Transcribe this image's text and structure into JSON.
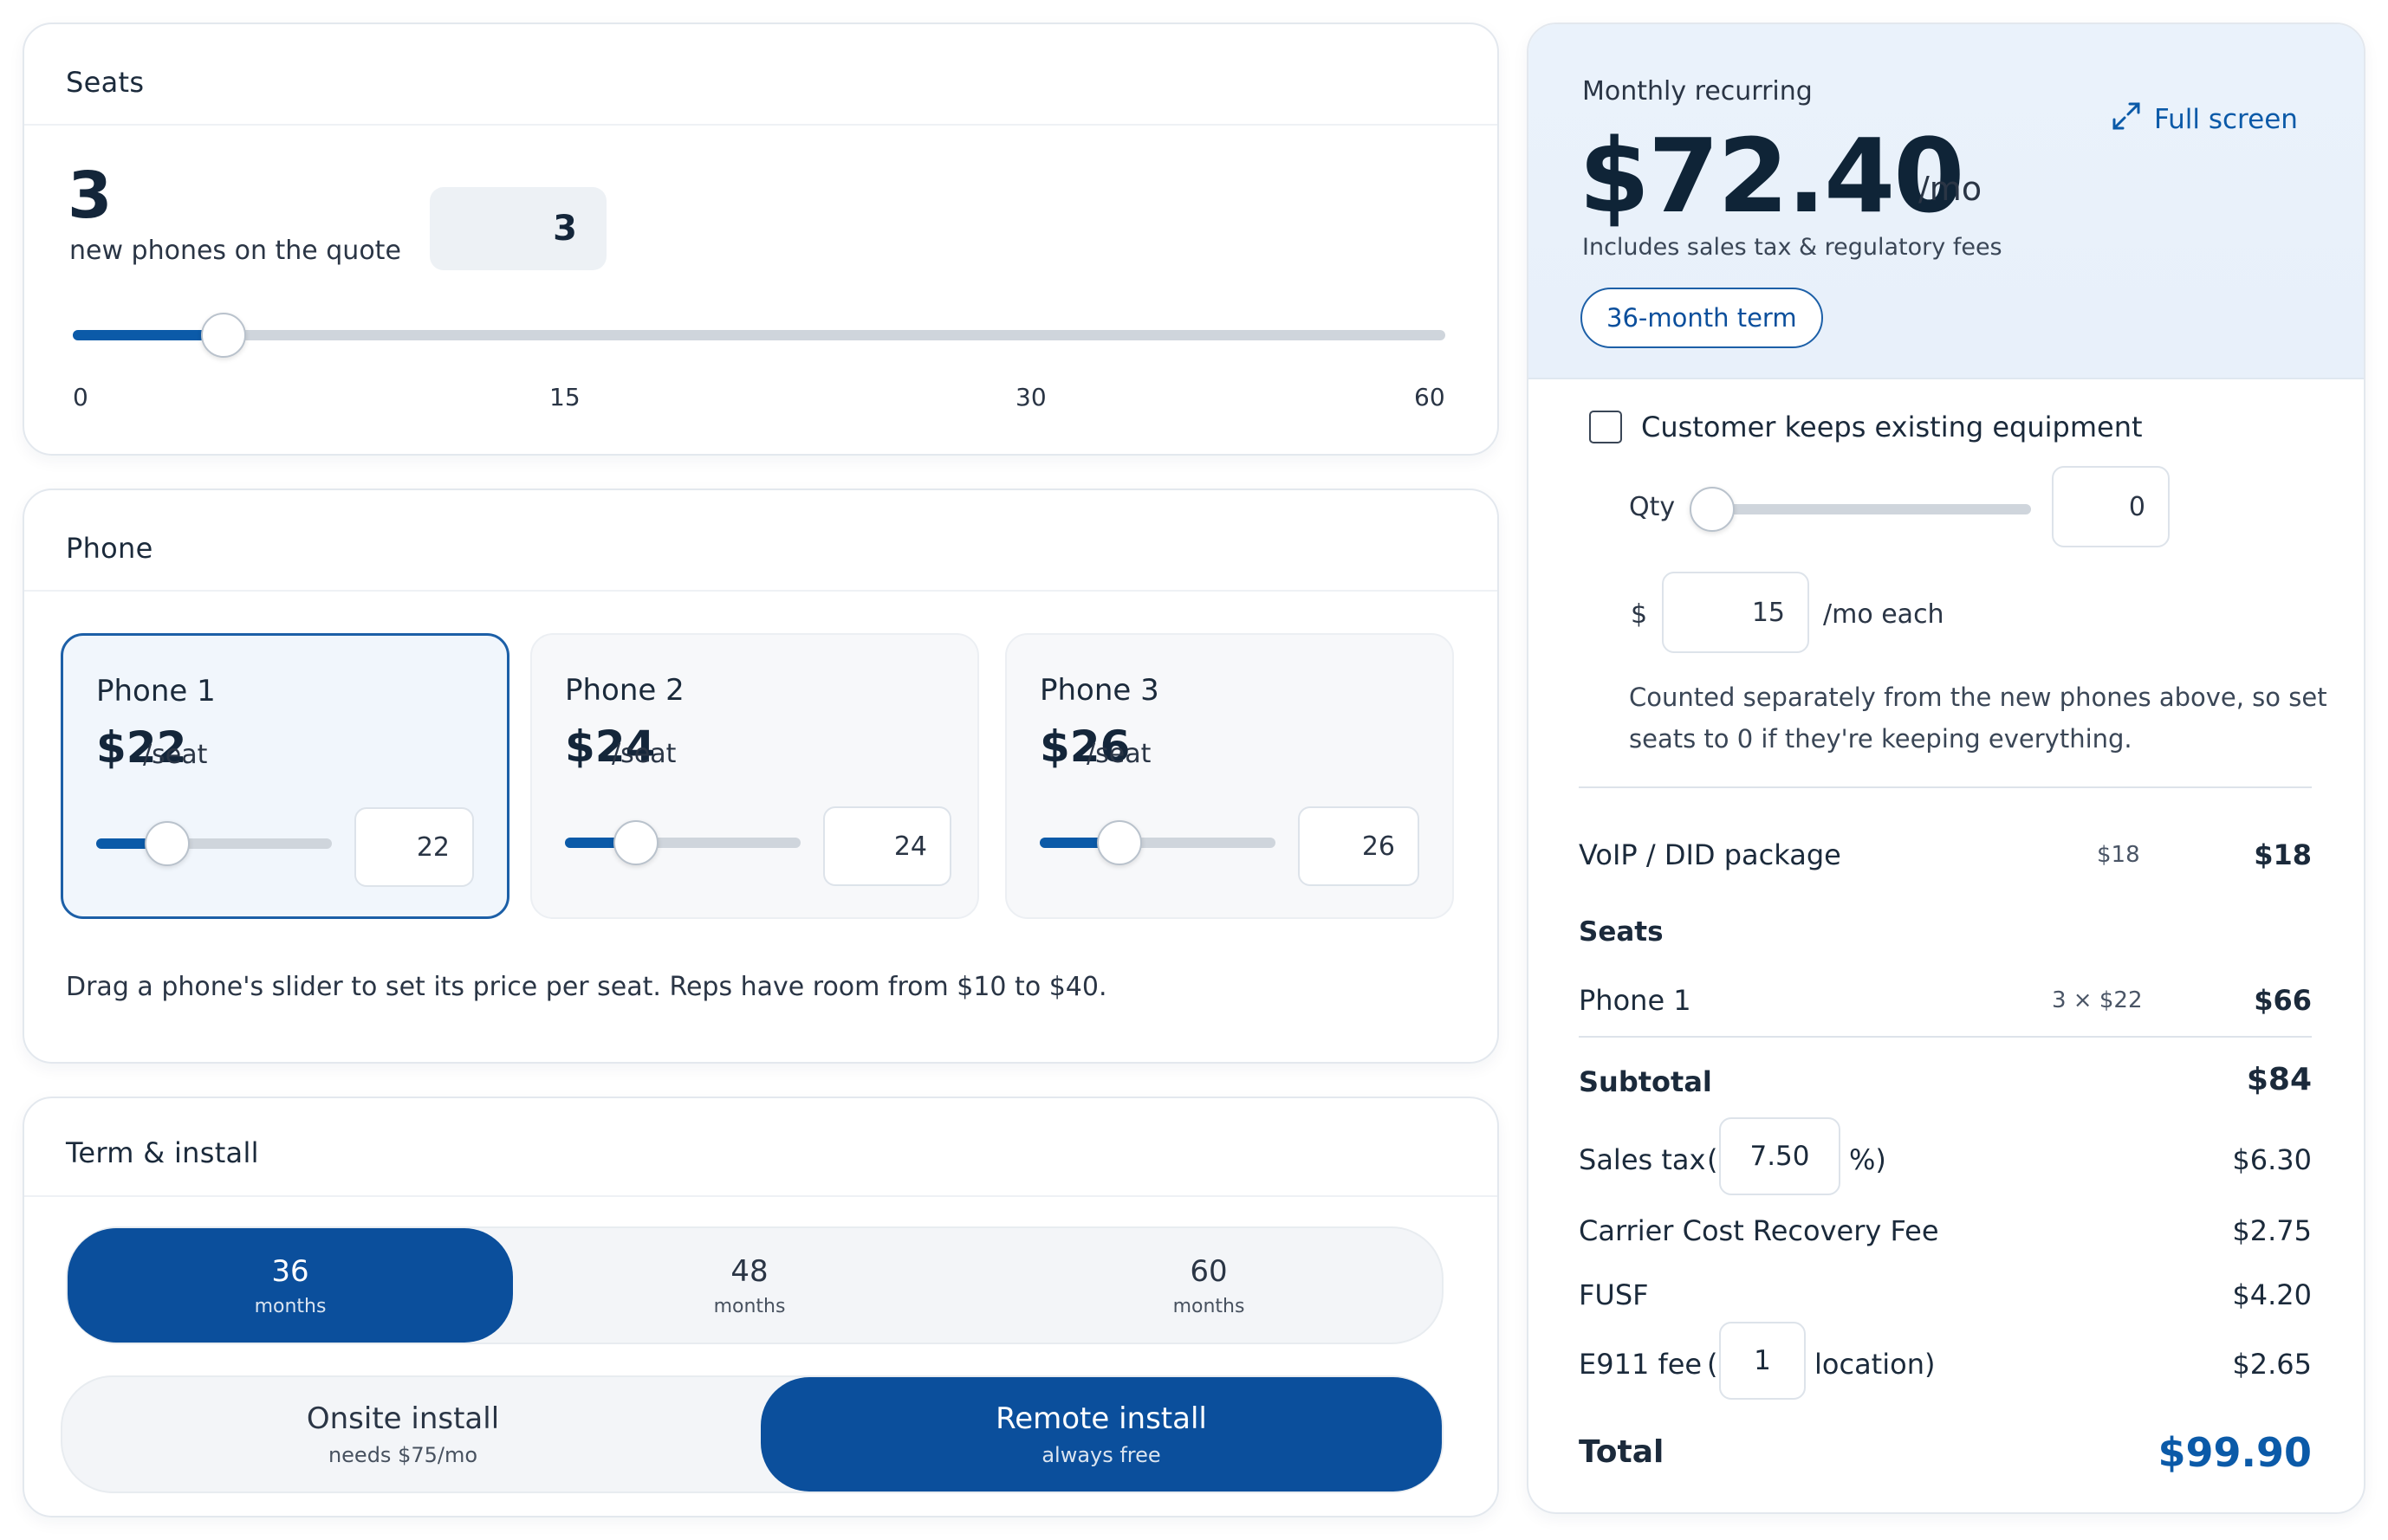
{
  "seats": {
    "title": "Seats",
    "count": "3",
    "caption": "new phones on the quote",
    "input_value": "3",
    "slider_value": 3,
    "slider_max": 60,
    "ticks": [
      "0",
      "15",
      "30",
      "60"
    ]
  },
  "phone": {
    "title": "Phone",
    "tiles": [
      {
        "name": "Phone 1",
        "price": "$22",
        "unit": "/seat",
        "value": "22",
        "selected": true
      },
      {
        "name": "Phone 2",
        "price": "$24",
        "unit": "/seat",
        "value": "24",
        "selected": false
      },
      {
        "name": "Phone 3",
        "price": "$26",
        "unit": "/seat",
        "value": "26",
        "selected": false
      }
    ],
    "hint": "Drag a phone's slider to set its price per seat. Reps have room from $10 to $40."
  },
  "term": {
    "title": "Term & install",
    "options": [
      {
        "value": "36",
        "label": "months",
        "active": true
      },
      {
        "value": "48",
        "label": "months",
        "active": false
      },
      {
        "value": "60",
        "label": "months",
        "active": false
      }
    ],
    "install": [
      {
        "label": "Onsite install",
        "sub": "needs $75/mo",
        "active": false
      },
      {
        "label": "Remote install",
        "sub": "always free",
        "active": true
      }
    ]
  },
  "summary": {
    "heading": "Monthly recurring",
    "amount": "$72.40",
    "per": "/mo",
    "note": "Includes sales tax & regulatory fees",
    "term_badge": "36-month term",
    "fullscreen": "Full screen",
    "equipment": {
      "checkbox_label": "Customer keeps existing equipment",
      "qty_label": "Qty",
      "qty_value": "0",
      "dollar": "$",
      "price_value": "15",
      "price_unit": "/mo each",
      "note_line1": "Counted separately from the new phones above, so set",
      "note_line2": "seats to 0 if they're keeping everything."
    },
    "lines": {
      "voip_label": "VoIP / DID package",
      "voip_mid": "$18",
      "voip_amount": "$18",
      "seats_header": "Seats",
      "phone_label": "Phone 1",
      "phone_mid": "3 × $22",
      "phone_amount": "$66",
      "subtotal_label": "Subtotal",
      "subtotal_amount": "$84",
      "tax_label": "Sales tax",
      "tax_open": "(",
      "tax_value": "7.50",
      "tax_close": "%)",
      "tax_amount": "$6.30",
      "ccrf_label": "Carrier Cost Recovery Fee",
      "ccrf_amount": "$2.75",
      "fusf_label": "FUSF",
      "fusf_amount": "$4.20",
      "e911_label": "E911 fee",
      "e911_open": "(",
      "e911_value": "1",
      "e911_close": "location)",
      "e911_amount": "$2.65",
      "total_label": "Total",
      "total_amount": "$99.90"
    }
  },
  "colors": {
    "accent": "#0b4f9c",
    "total": "#0b5aa8",
    "panel": "#eaf2fb"
  }
}
